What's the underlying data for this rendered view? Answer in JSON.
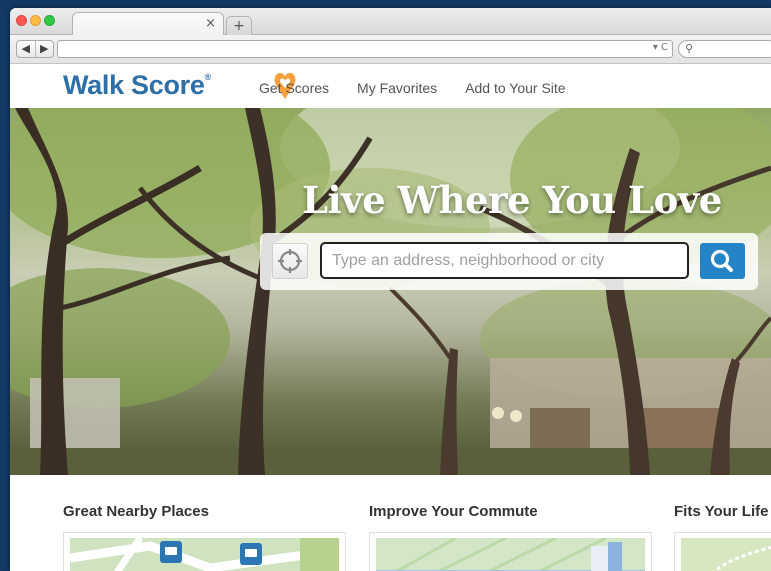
{
  "browser": {
    "tab_close_glyph": "×",
    "new_tab_glyph": "+",
    "back_glyph": "◀",
    "forward_glyph": "▶",
    "url_value": "",
    "url_icons": "▾ C",
    "search_glyph": "⚲"
  },
  "site": {
    "logo_text": "Walk Score",
    "logo_reg": "®",
    "logo_heart_color": "#f5a03a",
    "brand_color": "#2e6fa8",
    "nav": [
      "Get Scores",
      "My Favorites",
      "Add to Your Site"
    ]
  },
  "hero": {
    "title": "Live Where You Love",
    "search_placeholder": "Type an address, neighborhood or city",
    "search_value": "",
    "search_button_color": "#2583c7"
  },
  "sections": [
    {
      "title": "Great Nearby Places"
    },
    {
      "title": "Improve Your Commute"
    },
    {
      "title": "Fits Your Life"
    }
  ]
}
